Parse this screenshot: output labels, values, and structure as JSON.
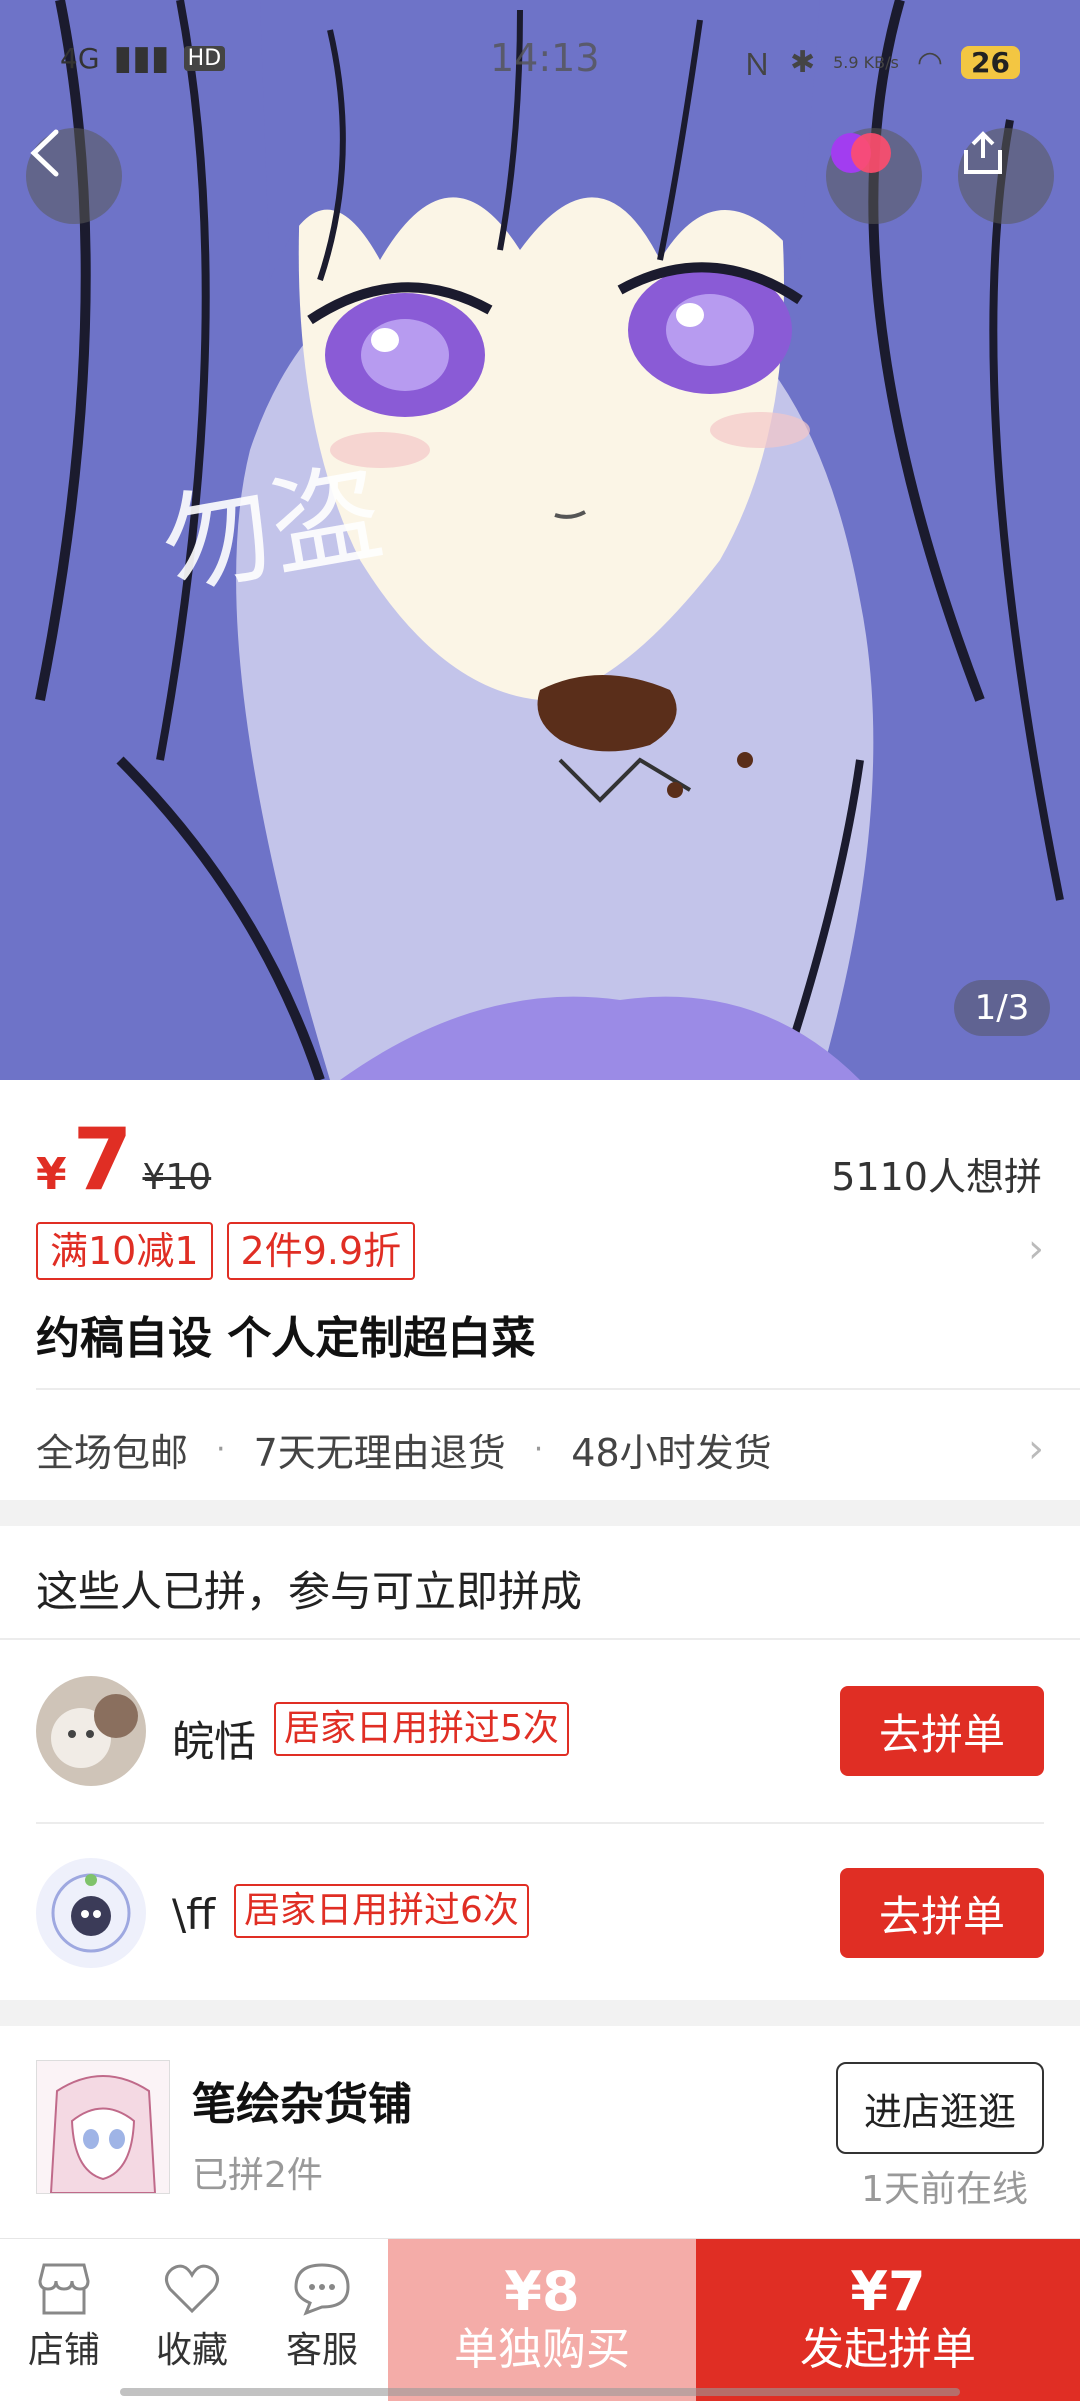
{
  "status_bar": {
    "network": "4G",
    "hd": "HD",
    "time": "14:13",
    "speed": "5.9 KB/s",
    "battery": "26"
  },
  "gallery": {
    "watermark": "勿盗",
    "page_indicator": "1/3"
  },
  "product": {
    "currency": "¥",
    "price": "7",
    "original_price": "¥10",
    "want_count": "5110人想拼",
    "promo_tags": [
      "满10减1",
      "2件9.9折"
    ],
    "title": "约稿自设 个人定制超白菜",
    "services": [
      "全场包邮",
      "7天无理由退货",
      "48小时发货"
    ]
  },
  "group_buy": {
    "title": "这些人已拼，参与可立即拼成",
    "members": [
      {
        "name": "皖恬",
        "tag": "居家日用拼过5次",
        "button": "去拼单"
      },
      {
        "name": "\\ff",
        "tag": "居家日用拼过6次",
        "button": "去拼单"
      }
    ]
  },
  "shop": {
    "name": "笔绘杂货铺",
    "sold": "已拼2件",
    "enter_button": "进店逛逛",
    "online_status": "1天前在线"
  },
  "bottom_bar": {
    "nav": [
      {
        "label": "店铺",
        "icon": "store-icon"
      },
      {
        "label": "收藏",
        "icon": "heart-icon"
      },
      {
        "label": "客服",
        "icon": "chat-icon"
      }
    ],
    "solo_price": "¥8",
    "solo_label": "单独购买",
    "group_price": "¥7",
    "group_label": "发起拼单"
  },
  "colors": {
    "accent": "#e02e24",
    "solo_button": "#f4aca8"
  }
}
